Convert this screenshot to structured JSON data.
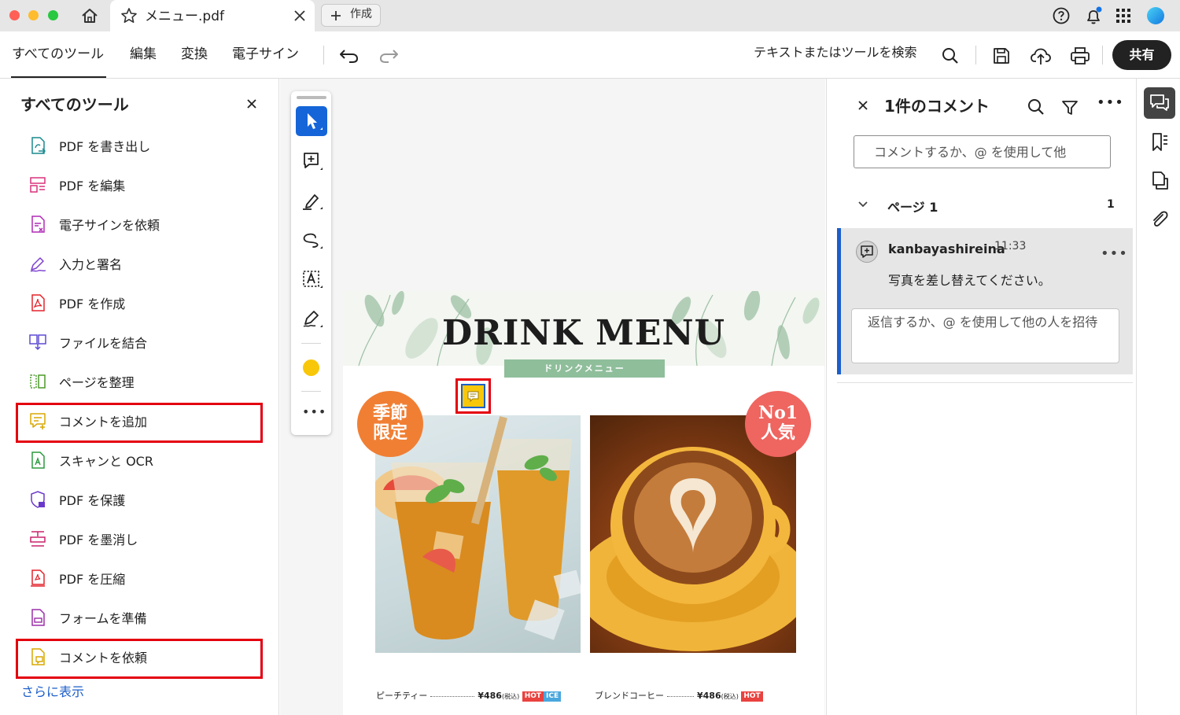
{
  "titlebar": {
    "tab_title": "メニュー.pdf",
    "create_label": "作成"
  },
  "toolbar": {
    "menu": [
      "すべてのツール",
      "編集",
      "変換",
      "電子サイン"
    ],
    "search_placeholder": "テキストまたはツールを検索",
    "share_label": "共有"
  },
  "left_panel": {
    "title": "すべてのツール",
    "tools": [
      {
        "label": "PDF を書き出し",
        "icon": "export-pdf-icon",
        "color": "#1a8a8e"
      },
      {
        "label": "PDF を編集",
        "icon": "edit-pdf-icon",
        "color": "#d9327c"
      },
      {
        "label": "電子サインを依頼",
        "icon": "request-esign-icon",
        "color": "#b02ab5"
      },
      {
        "label": "入力と署名",
        "icon": "fill-sign-icon",
        "color": "#7c3fce"
      },
      {
        "label": "PDF を作成",
        "icon": "create-pdf-icon",
        "color": "#e3242b"
      },
      {
        "label": "ファイルを結合",
        "icon": "combine-files-icon",
        "color": "#5e4bd6"
      },
      {
        "label": "ページを整理",
        "icon": "organize-pages-icon",
        "color": "#4c9a2a"
      },
      {
        "label": "コメントを追加",
        "icon": "add-comment-icon",
        "color": "#d9a700"
      },
      {
        "label": "スキャンと OCR",
        "icon": "scan-ocr-icon",
        "color": "#2b9a3f"
      },
      {
        "label": "PDF を保護",
        "icon": "protect-pdf-icon",
        "color": "#6a39c9"
      },
      {
        "label": "PDF を墨消し",
        "icon": "redact-pdf-icon",
        "color": "#c8246c"
      },
      {
        "label": "PDF を圧縮",
        "icon": "compress-pdf-icon",
        "color": "#e3242b"
      },
      {
        "label": "フォームを準備",
        "icon": "prepare-form-icon",
        "color": "#9b2ea8"
      },
      {
        "label": "コメントを依頼",
        "icon": "request-comments-icon",
        "color": "#d9a700"
      }
    ],
    "show_more": "さらに表示",
    "highlight_color": "#e4000f"
  },
  "document": {
    "title": "DRINK MENU",
    "subtitle": "ドリンクメニュー",
    "badge1": [
      "季節",
      "限定"
    ],
    "badge2": [
      "No1",
      "人気"
    ],
    "item1": {
      "name": "ピーチティー",
      "price": "¥486",
      "tax": "(税込)",
      "tags": [
        "HOT",
        "ICE"
      ]
    },
    "item2": {
      "name": "ブレンドコーヒー",
      "price": "¥486",
      "tax": "(税込)",
      "tags": [
        "HOT"
      ]
    }
  },
  "comments": {
    "title": "1件のコメント",
    "input_placeholder": "コメントするか、@ を使用して他",
    "page_label": "ページ 1",
    "page_count": "1",
    "items": [
      {
        "user": "kanbayashireina",
        "time": "11:33",
        "text": "写真を差し替えてください。",
        "reply_placeholder": "返信するか、@ を使用して他の人を招待"
      }
    ]
  },
  "colors": {
    "accent": "#1565d8",
    "marker_yellow": "#f8c70a"
  }
}
